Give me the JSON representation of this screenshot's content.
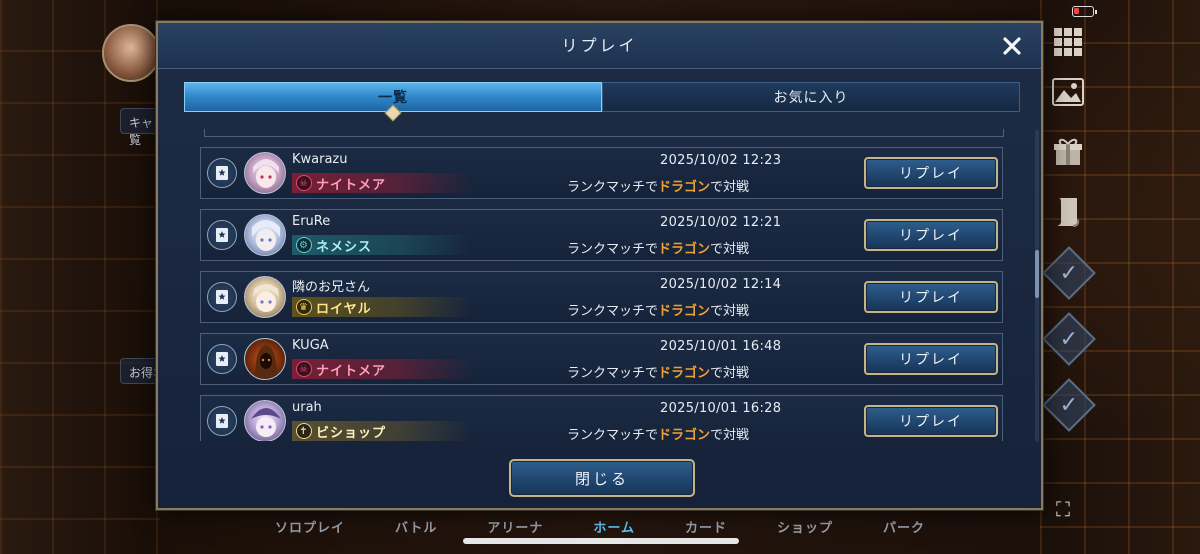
{
  "modal": {
    "title": "リプレイ",
    "tabs": [
      {
        "label": "一覧",
        "active": true
      },
      {
        "label": "お気に入り",
        "active": false
      }
    ],
    "close_button": "閉じる",
    "close_icon": "close-x-icon"
  },
  "replays": [
    {
      "name": "Kwarazu",
      "class": "ナイトメア",
      "class_icon": "nightmare-icon",
      "class_color": "#e0487a",
      "band": "#7a1f36",
      "date": "2025/10/02 12:23",
      "desc_pre": "ランクマッチで",
      "opponent": "ドラゴン",
      "desc_post": "で対戦",
      "button": "リプレイ"
    },
    {
      "name": "EruRe",
      "class": "ネメシス",
      "class_icon": "nemesis-icon",
      "class_color": "#5fd0d8",
      "band": "#1f5a66",
      "date": "2025/10/02 12:21",
      "desc_pre": "ランクマッチで",
      "opponent": "ドラゴン",
      "desc_post": "で対戦",
      "button": "リプレイ"
    },
    {
      "name": "隣のお兄さん",
      "class": "ロイヤル",
      "class_icon": "royal-icon",
      "class_color": "#e8c84a",
      "band": "#5e5220",
      "date": "2025/10/02 12:14",
      "desc_pre": "ランクマッチで",
      "opponent": "ドラゴン",
      "desc_post": "で対戦",
      "button": "リプレイ"
    },
    {
      "name": "KUGA",
      "class": "ナイトメア",
      "class_icon": "nightmare-icon",
      "class_color": "#e0487a",
      "band": "#7a1f36",
      "date": "2025/10/01 16:48",
      "desc_pre": "ランクマッチで",
      "opponent": "ドラゴン",
      "desc_post": "で対戦",
      "button": "リプレイ"
    },
    {
      "name": "urah",
      "class": "ビショップ",
      "class_icon": "bishop-icon",
      "class_color": "#e6d8a0",
      "band": "#5a5030",
      "date": "2025/10/01 16:28",
      "desc_pre": "ランクマッチで",
      "opponent": "ドラゴン",
      "desc_post": "で対戦",
      "button": "リプレイ"
    }
  ],
  "background": {
    "chips": [
      "キャンペーン一覧",
      "お得なクリ"
    ],
    "nav": [
      "ソロプレイ",
      "バトル",
      "アリーナ",
      "ホーム",
      "カード",
      "ショップ",
      "パーク"
    ],
    "nav_active": "ホーム",
    "side_icons": [
      "menu-grid-icon",
      "gallery-icon",
      "gift-icon",
      "scroll-icon",
      "mission-check-icon",
      "mission-check-icon",
      "mission-check-icon"
    ]
  },
  "colors": {
    "accent": "#5db5ea",
    "frame": "#c5b38a",
    "highlight": "#f2a033"
  }
}
